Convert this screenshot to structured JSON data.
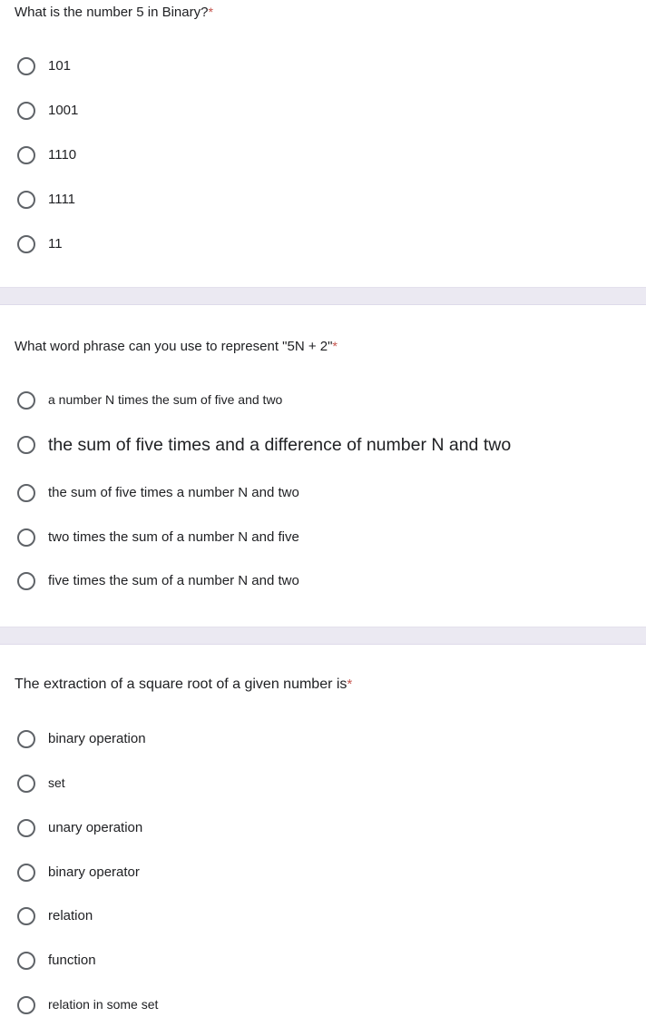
{
  "form": {
    "required_marker": "*",
    "accent_required_color": "#c5554e",
    "separator_color": "#ebe9f2",
    "radio_color": "#5f6368",
    "text_color": "#202124"
  },
  "questions": [
    {
      "title": "What is the number 5 in Binary?",
      "required": true,
      "options": [
        {
          "label": "101"
        },
        {
          "label": "1001"
        },
        {
          "label": "1110"
        },
        {
          "label": "1111"
        },
        {
          "label": "11"
        }
      ]
    },
    {
      "title": "What word phrase can you use to represent \"5N + 2\"",
      "required": true,
      "options": [
        {
          "label": "a number N times the sum of five and two"
        },
        {
          "label": "the sum of five times and a difference of number N and two"
        },
        {
          "label": "the sum of five times a number N and two"
        },
        {
          "label": "two times the sum of a number N and five"
        },
        {
          "label": "five times the sum of a number N and two"
        }
      ]
    },
    {
      "title": "The extraction of a square root of a given number is",
      "required": true,
      "options": [
        {
          "label": "binary operation"
        },
        {
          "label": "set"
        },
        {
          "label": "unary operation"
        },
        {
          "label": "binary operator"
        },
        {
          "label": "relation"
        },
        {
          "label": "function"
        },
        {
          "label": "relation in some set"
        }
      ]
    }
  ]
}
